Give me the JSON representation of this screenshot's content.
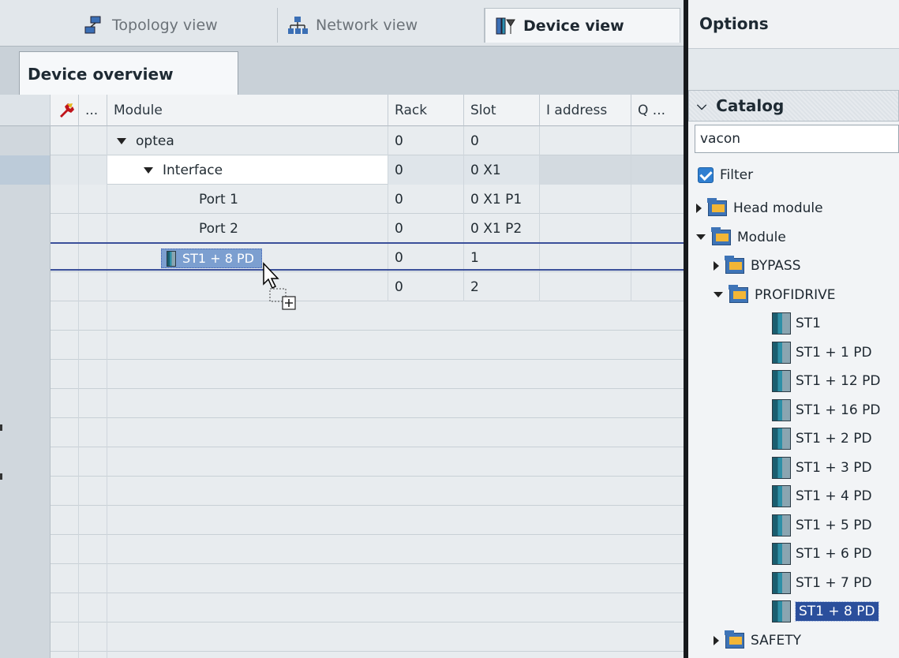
{
  "view_tabs": [
    {
      "label": "Topology view",
      "icon": "topology-icon",
      "active": false
    },
    {
      "label": "Network view",
      "icon": "network-icon",
      "active": false
    },
    {
      "label": "Device view",
      "icon": "device-icon",
      "active": true
    }
  ],
  "subtabs": {
    "overview": "Device overview"
  },
  "table": {
    "headers": {
      "gutter": "...",
      "module": "Module",
      "rack": "Rack",
      "slot": "Slot",
      "iaddress": "I address",
      "q": "Q ..."
    },
    "rows": [
      {
        "module": "optea",
        "rack": "0",
        "slot": "0",
        "expanded": true,
        "indent": 0
      },
      {
        "module": "Interface",
        "rack": "0",
        "slot": "0 X1",
        "expanded": true,
        "indent": 1
      },
      {
        "module": "Port 1",
        "rack": "0",
        "slot": "0 X1 P1",
        "indent": 2
      },
      {
        "module": "Port 2",
        "rack": "0",
        "slot": "0 X1 P2",
        "indent": 2
      },
      {
        "module": "",
        "rack": "0",
        "slot": "1",
        "indent": 1
      },
      {
        "module": "",
        "rack": "0",
        "slot": "2",
        "indent": 1
      }
    ],
    "drag_item": "ST1 + 8 PD"
  },
  "options": {
    "title": "Options"
  },
  "catalog": {
    "title": "Catalog",
    "search_value": "vacon",
    "filter_label": "Filter",
    "tree": [
      {
        "label": "Head module",
        "type": "folder",
        "expanded": false,
        "level": 0
      },
      {
        "label": "Module",
        "type": "folder",
        "expanded": true,
        "level": 0
      },
      {
        "label": "BYPASS",
        "type": "folder",
        "expanded": false,
        "level": 1
      },
      {
        "label": "PROFIDRIVE",
        "type": "folder",
        "expanded": true,
        "level": 1
      },
      {
        "label": "ST1",
        "type": "module",
        "level": 2
      },
      {
        "label": "ST1 + 1 PD",
        "type": "module",
        "level": 2
      },
      {
        "label": "ST1 + 12 PD",
        "type": "module",
        "level": 2
      },
      {
        "label": "ST1 + 16 PD",
        "type": "module",
        "level": 2
      },
      {
        "label": "ST1 + 2 PD",
        "type": "module",
        "level": 2
      },
      {
        "label": "ST1 + 3 PD",
        "type": "module",
        "level": 2
      },
      {
        "label": "ST1 + 4 PD",
        "type": "module",
        "level": 2
      },
      {
        "label": "ST1 + 5 PD",
        "type": "module",
        "level": 2
      },
      {
        "label": "ST1 + 6 PD",
        "type": "module",
        "level": 2
      },
      {
        "label": "ST1 + 7 PD",
        "type": "module",
        "level": 2
      },
      {
        "label": "ST1 + 8 PD",
        "type": "module",
        "level": 2,
        "selected": true
      },
      {
        "label": "SAFETY",
        "type": "folder",
        "expanded": false,
        "level": 1
      }
    ]
  }
}
